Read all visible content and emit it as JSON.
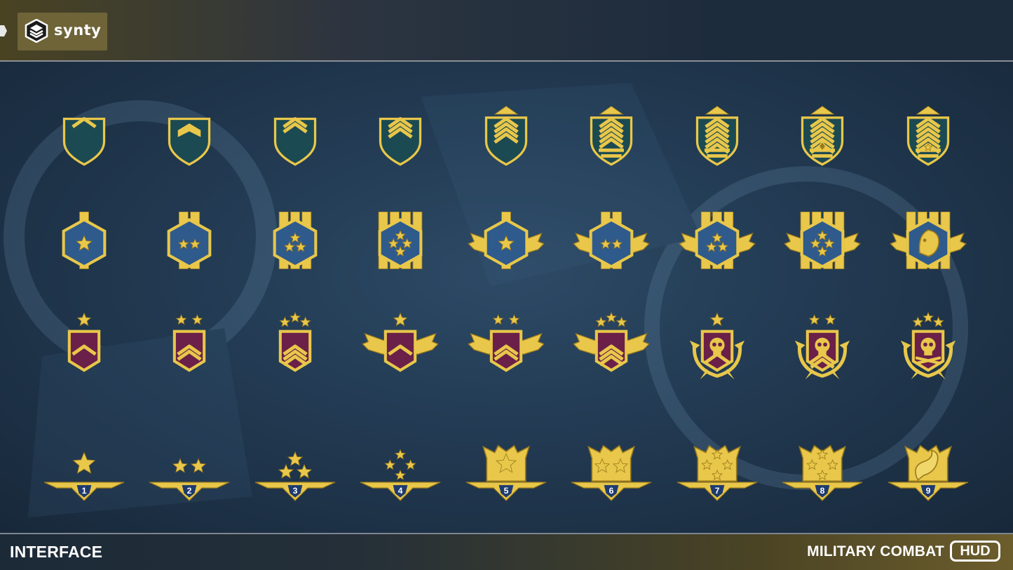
{
  "brand": {
    "name": "synty",
    "logo_icon": "synty-logo-icon"
  },
  "footer": {
    "section_title": "INTERFACE",
    "product_title": "MILITARY COMBAT",
    "product_badge": "HUD"
  },
  "colors": {
    "gold": "#e8c74a",
    "gold_dark": "#9a7a1c",
    "teal_fill": "#1c4a52",
    "blue_fill": "#2f5a8c",
    "purple_fill": "#6a2048",
    "background": "#223a52"
  },
  "rank_rows": [
    {
      "row": "chevron-shields",
      "count": 9,
      "fill": "teal",
      "icons": [
        "chevron-1-icon",
        "chevron-2-icon",
        "chevron-3-icon",
        "chevron-4-icon",
        "chevron-5-icon",
        "chevron-6-icon",
        "chevron-7-icon",
        "chevron-diamond-icon",
        "chevron-star-icon"
      ]
    },
    {
      "row": "hexagon-star-badges",
      "count": 9,
      "fill": "blue",
      "icons": [
        "hex-1-star-icon",
        "hex-2-star-icon",
        "hex-3-star-icon",
        "hex-4-star-icon",
        "winged-hex-1-star-icon",
        "winged-hex-2-star-icon",
        "winged-hex-3-star-icon",
        "winged-hex-4-star-icon",
        "winged-hex-wolf-icon"
      ]
    },
    {
      "row": "purple-shield-badges",
      "count": 9,
      "fill": "purple",
      "icons": [
        "purple-shield-1-icon",
        "purple-shield-2-icon",
        "purple-shield-3-icon",
        "winged-purple-1-icon",
        "winged-purple-2-icon",
        "winged-purple-3-icon",
        "skull-wreath-1-icon",
        "skull-wreath-2-icon",
        "skull-crossbones-icon"
      ]
    },
    {
      "row": "numbered-wing-badges",
      "count": 9,
      "fill": "navy",
      "numbers": [
        "1",
        "2",
        "3",
        "4",
        "5",
        "6",
        "7",
        "8",
        "9"
      ],
      "icons": [
        "wing-1-icon",
        "wing-2-icon",
        "wing-3-icon",
        "wing-4-icon",
        "wing-5-icon",
        "wing-6-icon",
        "wing-7-icon",
        "wing-8-icon",
        "wing-snake-icon"
      ]
    }
  ]
}
